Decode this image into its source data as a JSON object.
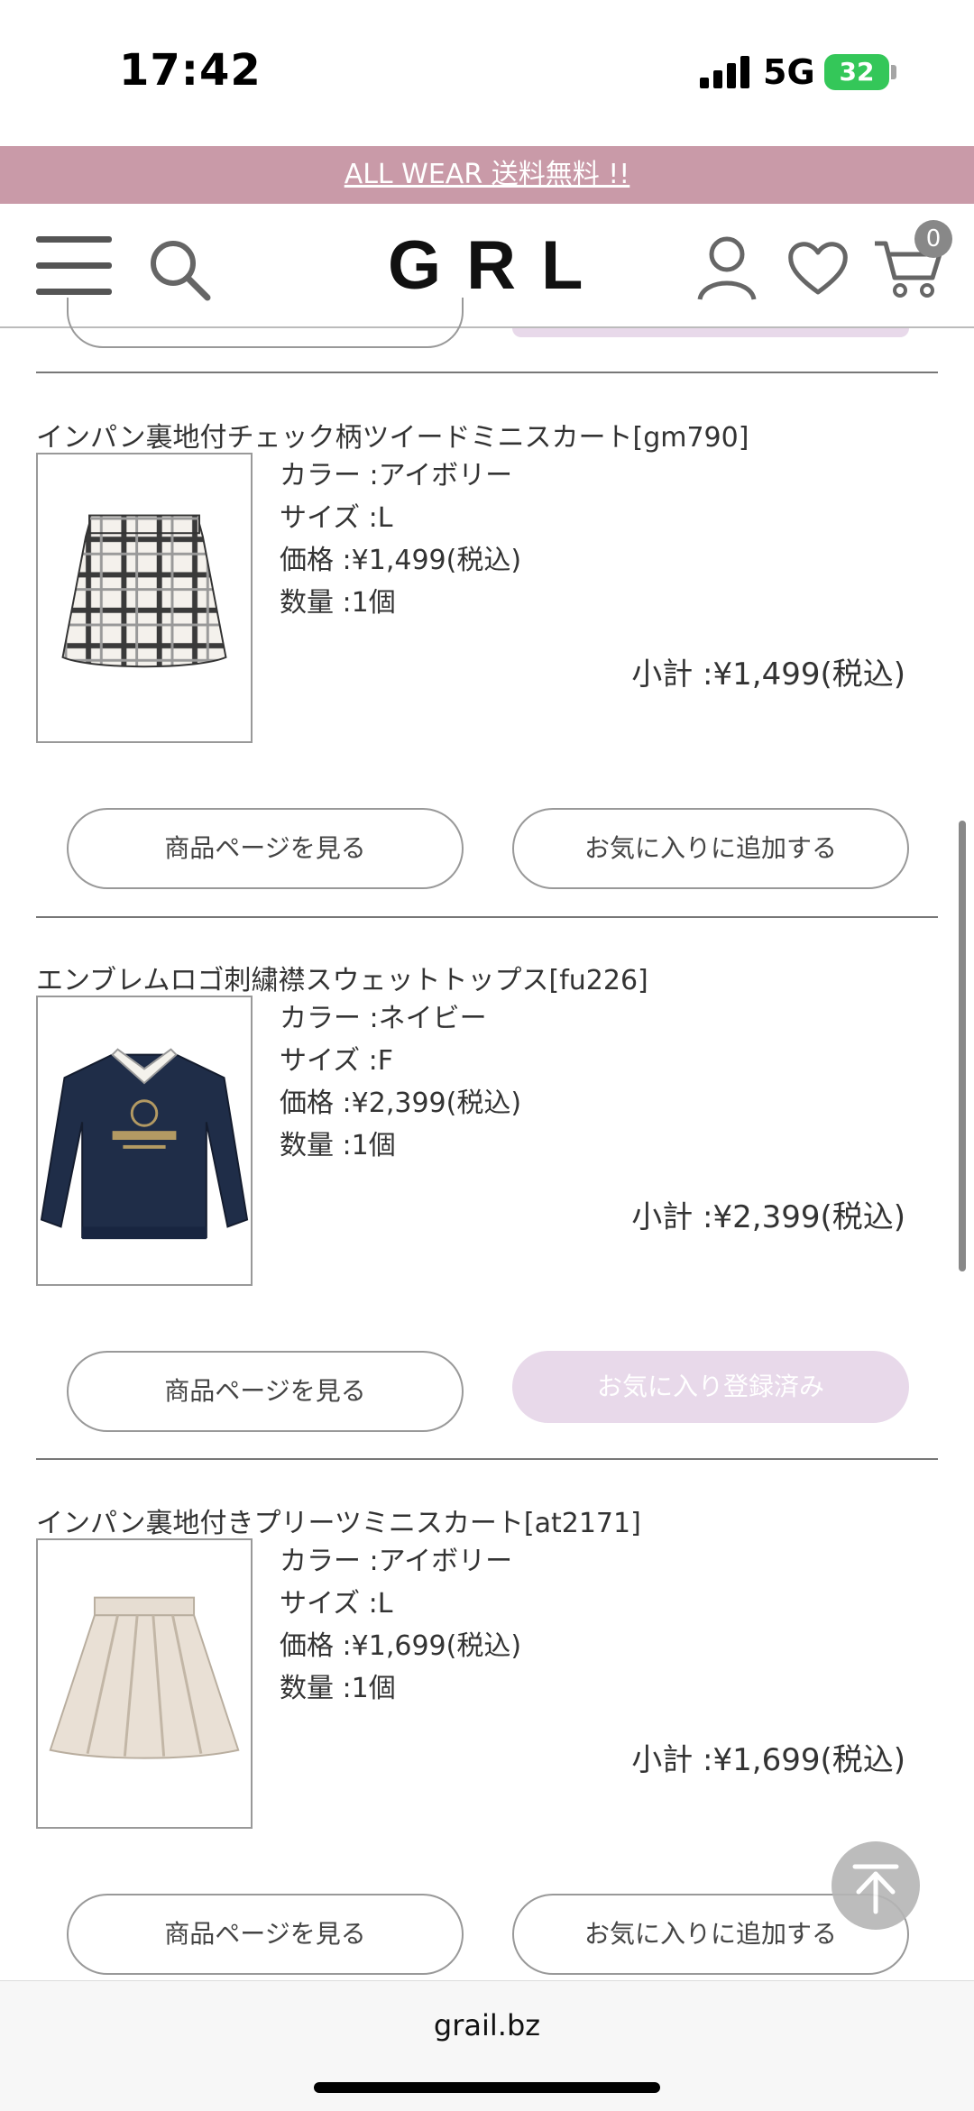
{
  "status_bar": {
    "time": "17:42",
    "network": "5G",
    "battery": "32"
  },
  "promo_banner": {
    "text": "ALL WEAR 送料無料 !!"
  },
  "header": {
    "logo": "GRL",
    "cart_count": "0"
  },
  "items": [
    {
      "title": "インパン裏地付チェック柄ツイードミニスカート[gm790]",
      "color": "カラー :アイボリー",
      "size": "サイズ :L",
      "price": "価格 :¥1,499(税込)",
      "quantity": "数量 :1個",
      "subtotal": "小計 :¥1,499(税込)",
      "view_button": "商品ページを見る",
      "favorite_button": "お気に入りに追加する",
      "favorite_registered": false
    },
    {
      "title": "エンブレムロゴ刺繍襟スウェットトップス[fu226]",
      "color": "カラー :ネイビー",
      "size": "サイズ :F",
      "price": "価格 :¥2,399(税込)",
      "quantity": "数量 :1個",
      "subtotal": "小計 :¥2,399(税込)",
      "view_button": "商品ページを見る",
      "favorite_button": "お気に入り登録済み",
      "favorite_registered": true
    },
    {
      "title": "インパン裏地付きプリーツミニスカート[at2171]",
      "color": "カラー :アイボリー",
      "size": "サイズ :L",
      "price": "価格 :¥1,699(税込)",
      "quantity": "数量 :1個",
      "subtotal": "小計 :¥1,699(税込)",
      "view_button": "商品ページを見る",
      "favorite_button": "お気に入りに追加する",
      "favorite_registered": false
    }
  ],
  "browser": {
    "url": "grail.bz"
  },
  "colors": {
    "promo": "#c99aa8",
    "registered_button": "#e8d9ea",
    "battery": "#34c759"
  },
  "icons": [
    "menu-icon",
    "search-icon",
    "user-icon",
    "heart-icon",
    "cart-icon",
    "arrow-up-icon"
  ]
}
